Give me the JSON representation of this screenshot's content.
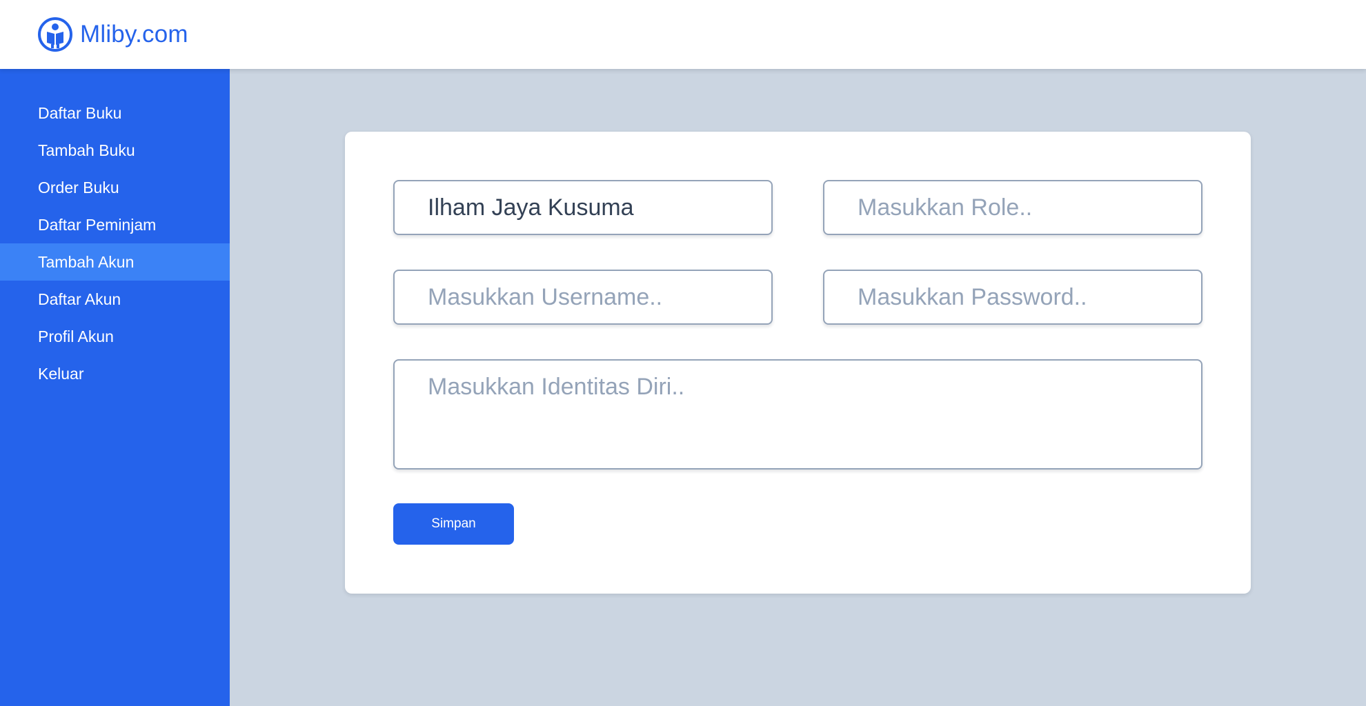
{
  "header": {
    "brand": "Mliby.com",
    "logo_icon": "reader-book-icon"
  },
  "colors": {
    "primary": "#2563eb",
    "sidebar_active": "#3b82f6",
    "background": "#cbd5e1",
    "placeholder": "#94a3b8",
    "text": "#334155"
  },
  "sidebar": {
    "items": [
      {
        "label": "Daftar Buku"
      },
      {
        "label": "Tambah Buku"
      },
      {
        "label": "Order Buku"
      },
      {
        "label": "Daftar Peminjam"
      },
      {
        "label": "Tambah Akun",
        "active": true
      },
      {
        "label": "Daftar Akun"
      },
      {
        "label": "Profil Akun"
      },
      {
        "label": "Keluar"
      }
    ]
  },
  "form": {
    "name": {
      "value": "Ilham Jaya Kusuma"
    },
    "role": {
      "value": "",
      "placeholder": "Masukkan Role.."
    },
    "username": {
      "value": "",
      "placeholder": "Masukkan Username.."
    },
    "password": {
      "value": "",
      "placeholder": "Masukkan Password.."
    },
    "identity": {
      "value": "",
      "placeholder": "Masukkan Identitas Diri.."
    },
    "submit_label": "Simpan"
  }
}
